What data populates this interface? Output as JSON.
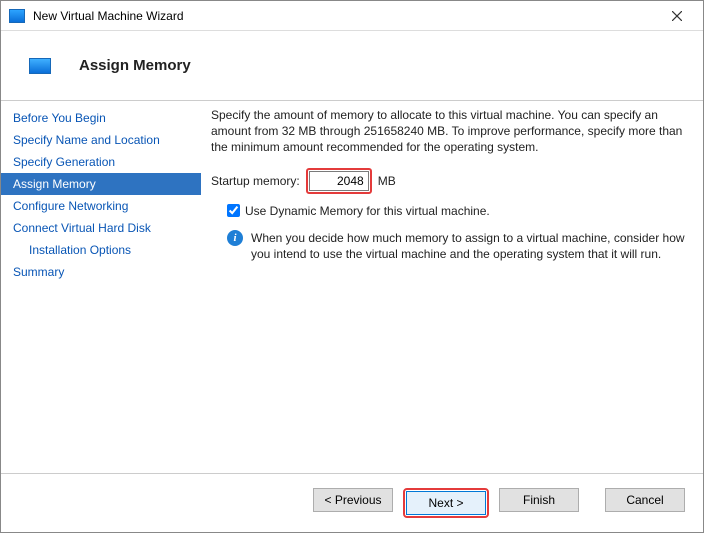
{
  "window": {
    "title": "New Virtual Machine Wizard"
  },
  "header": {
    "step_title": "Assign Memory"
  },
  "sidebar": {
    "items": [
      {
        "label": "Before You Begin"
      },
      {
        "label": "Specify Name and Location"
      },
      {
        "label": "Specify Generation"
      },
      {
        "label": "Assign Memory"
      },
      {
        "label": "Configure Networking"
      },
      {
        "label": "Connect Virtual Hard Disk"
      },
      {
        "label": "Installation Options"
      },
      {
        "label": "Summary"
      }
    ]
  },
  "content": {
    "intro": "Specify the amount of memory to allocate to this virtual machine. You can specify an amount from 32 MB through 251658240 MB. To improve performance, specify more than the minimum amount recommended for the operating system.",
    "startup_label": "Startup memory:",
    "startup_value": "2048",
    "startup_unit": "MB",
    "dynamic_checkbox_label": "Use Dynamic Memory for this virtual machine.",
    "dynamic_checked": true,
    "info_text": "When you decide how much memory to assign to a virtual machine, consider how you intend to use the virtual machine and the operating system that it will run."
  },
  "buttons": {
    "previous": "< Previous",
    "next": "Next >",
    "finish": "Finish",
    "cancel": "Cancel"
  }
}
